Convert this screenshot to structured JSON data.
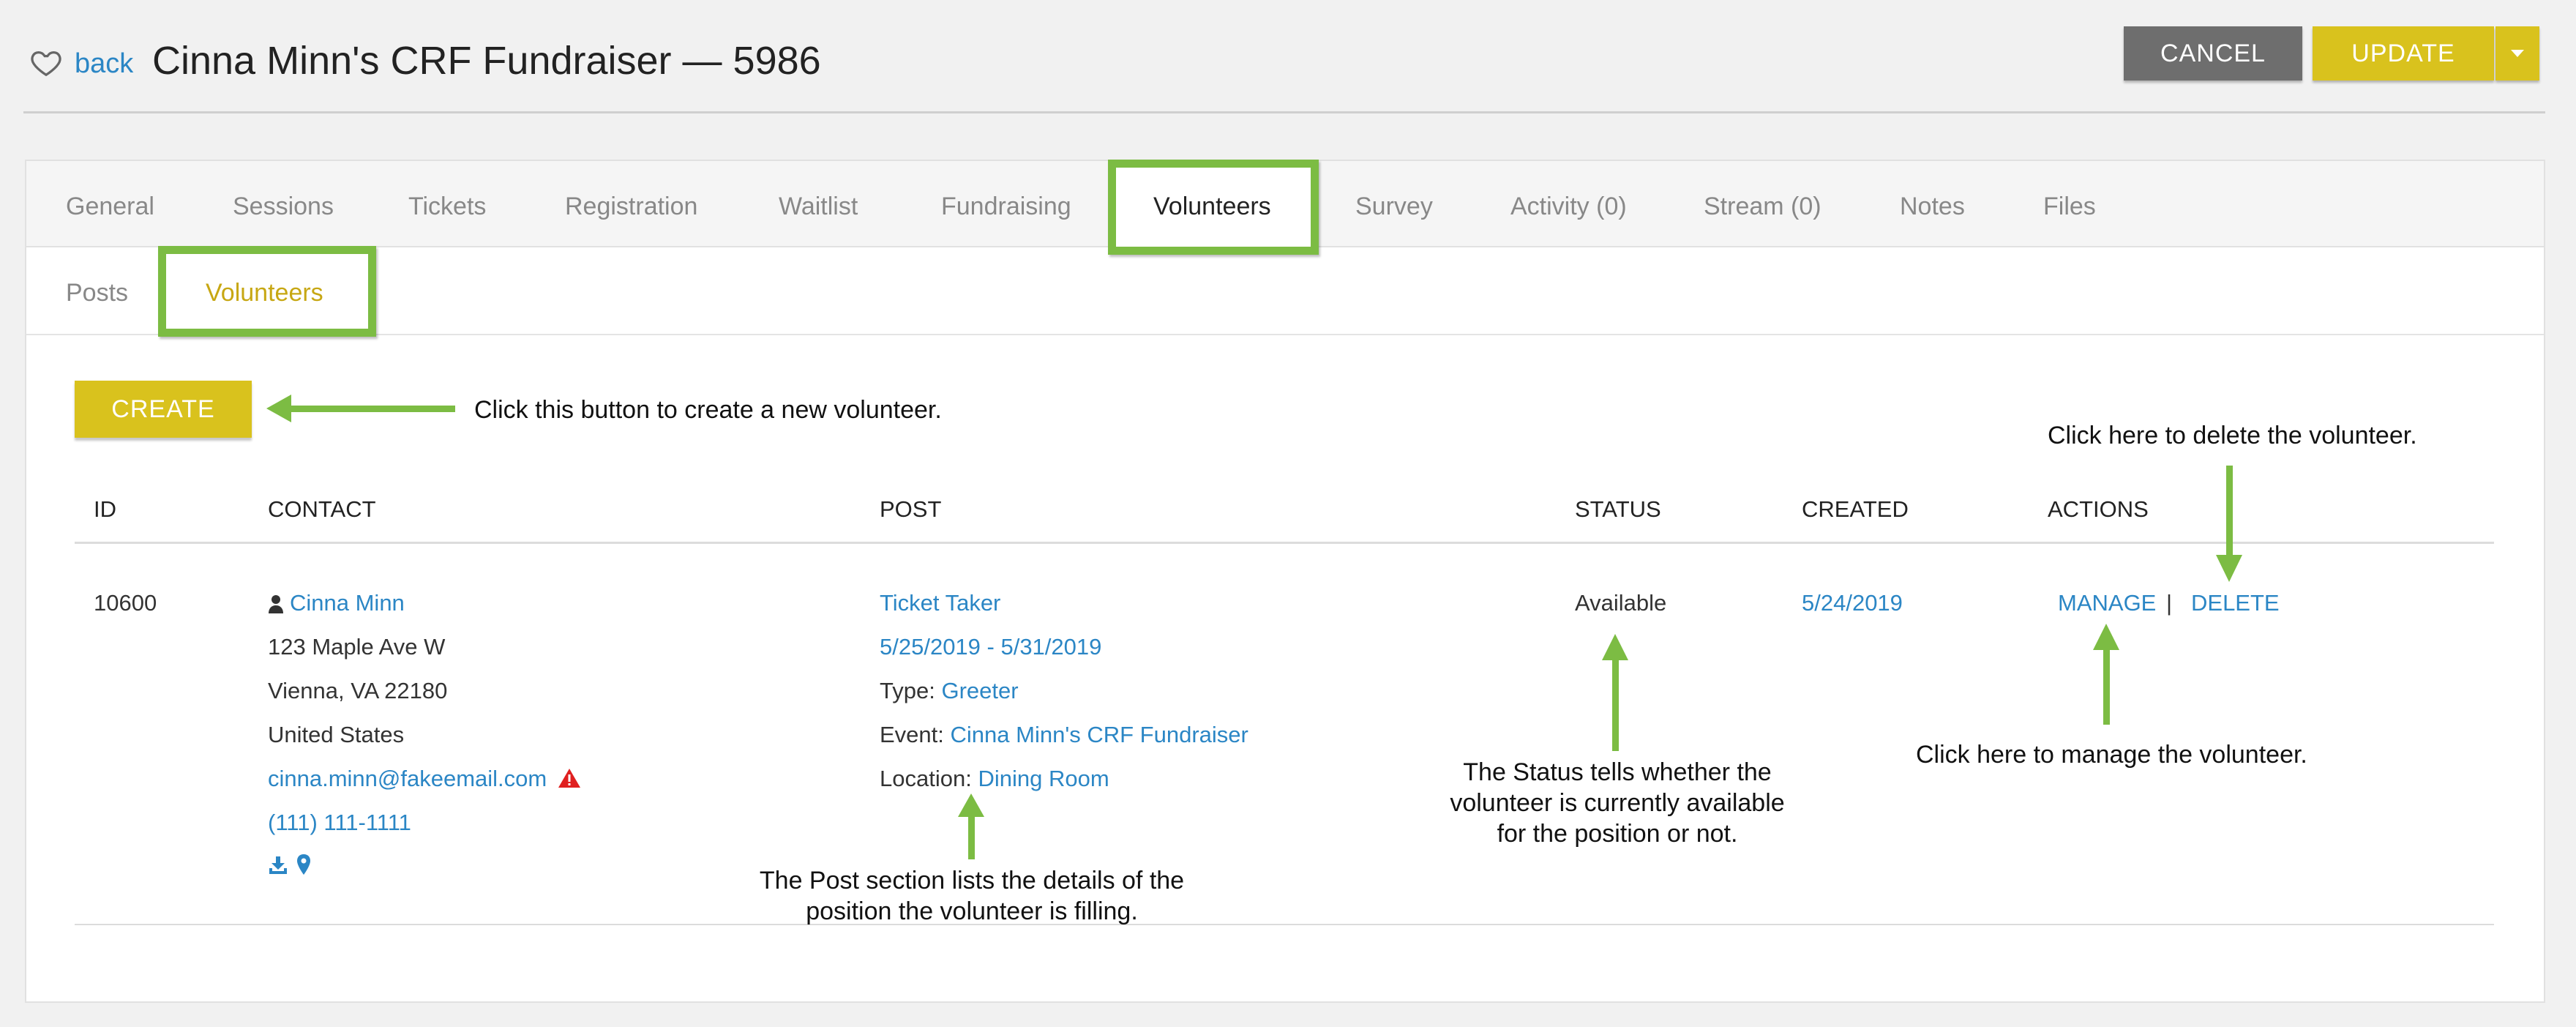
{
  "header": {
    "back_label": "back",
    "title": "Cinna Minn's CRF Fundraiser — 5986",
    "cancel_label": "CANCEL",
    "update_label": "UPDATE",
    "icons": {
      "favorite": "heart-outline-icon",
      "dropdown": "caret-down-icon"
    }
  },
  "tabs": [
    {
      "label": "General"
    },
    {
      "label": "Sessions"
    },
    {
      "label": "Tickets"
    },
    {
      "label": "Registration"
    },
    {
      "label": "Waitlist"
    },
    {
      "label": "Fundraising"
    },
    {
      "label": "Volunteers",
      "active": true
    },
    {
      "label": "Survey"
    },
    {
      "label": "Activity (0)"
    },
    {
      "label": "Stream (0)"
    },
    {
      "label": "Notes"
    },
    {
      "label": "Files"
    }
  ],
  "subtabs": [
    {
      "label": "Posts"
    },
    {
      "label": "Volunteers",
      "active": true
    }
  ],
  "create_label": "CREATE",
  "table": {
    "headers": [
      "ID",
      "CONTACT",
      "POST",
      "STATUS",
      "CREATED",
      "ACTIONS"
    ],
    "row": {
      "id": "10600",
      "contact": {
        "name": "Cinna Minn",
        "address1": "123 Maple Ave W",
        "address2": "Vienna, VA 22180",
        "country": "United States",
        "email": "cinna.minn@fakeemail.com",
        "phone": "(111) 111-1111"
      },
      "post": {
        "title": "Ticket Taker",
        "dates": "5/25/2019 - 5/31/2019",
        "type_label": "Type:",
        "type": "Greeter",
        "event_label": "Event:",
        "event": "Cinna Minn's CRF Fundraiser",
        "location_label": "Location:",
        "location": "Dining Room"
      },
      "status": "Available",
      "created": "5/24/2019",
      "manage_label": "MANAGE",
      "separator": "|",
      "delete_label": "DELETE"
    }
  },
  "annotations": {
    "create": "Click this button to create a new volunteer.",
    "delete": "Click here to delete the volunteer.",
    "manage": "Click here to manage the volunteer.",
    "status_line1": "The Status tells whether the",
    "status_line2": "volunteer is currently available",
    "status_line3": "for the position or not.",
    "post_line1": "The Post section lists the details of the",
    "post_line2": "position the volunteer is filling."
  },
  "colors": {
    "accent_yellow": "#d9c21d",
    "highlight_green": "#7cbc43",
    "link_blue": "#2b86c5",
    "cancel_gray": "#6e6e6e",
    "warning_red": "#e02020"
  }
}
